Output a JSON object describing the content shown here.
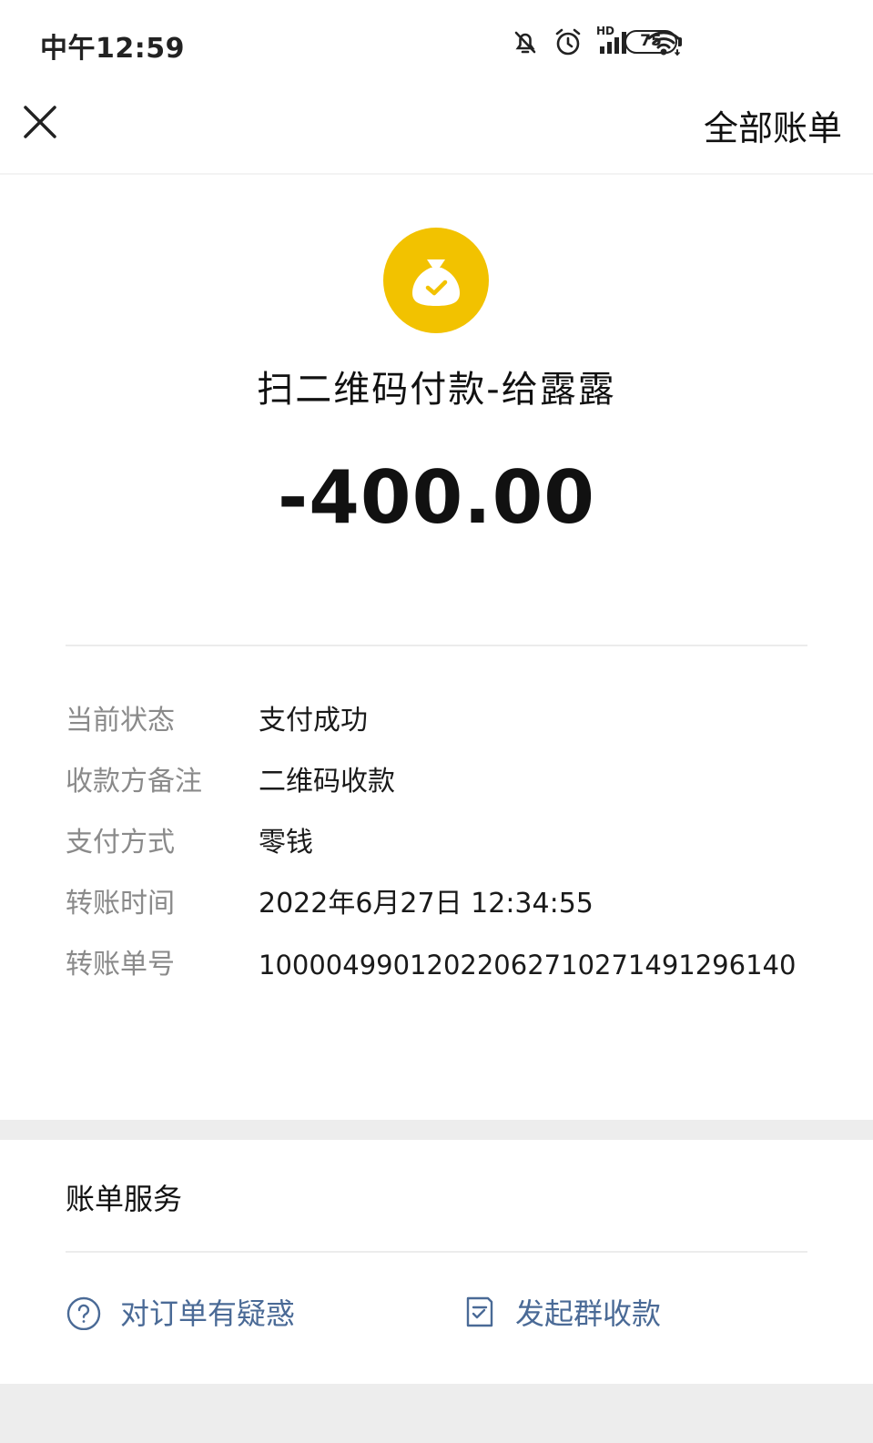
{
  "status_bar": {
    "time": "中午12:59",
    "network_label": "HD",
    "battery": "75",
    "icons": [
      "bell-mute-icon",
      "alarm-icon",
      "signal-icon",
      "wifi-icon",
      "battery-icon"
    ]
  },
  "nav": {
    "close_icon": "close-icon",
    "all_bills_label": "全部账单"
  },
  "payment": {
    "icon": "money-bag-check-icon",
    "icon_color": "#F2C200",
    "merchant": "扫二维码付款-给露露",
    "amount": "-400.00"
  },
  "details": [
    {
      "label": "当前状态",
      "value": "支付成功"
    },
    {
      "label": "收款方备注",
      "value": "二维码收款"
    },
    {
      "label": "支付方式",
      "value": "零钱"
    },
    {
      "label": "转账时间",
      "value": "2022年6月27日 12:34:55"
    },
    {
      "label": "转账单号",
      "value": "10000499012022062710271491296140"
    }
  ],
  "service": {
    "title": "账单服务",
    "actions": [
      {
        "label": "对订单有疑惑",
        "icon": "question-circle-icon"
      },
      {
        "label": "发起群收款",
        "icon": "document-check-icon"
      }
    ],
    "link_color": "#4A6A96"
  }
}
